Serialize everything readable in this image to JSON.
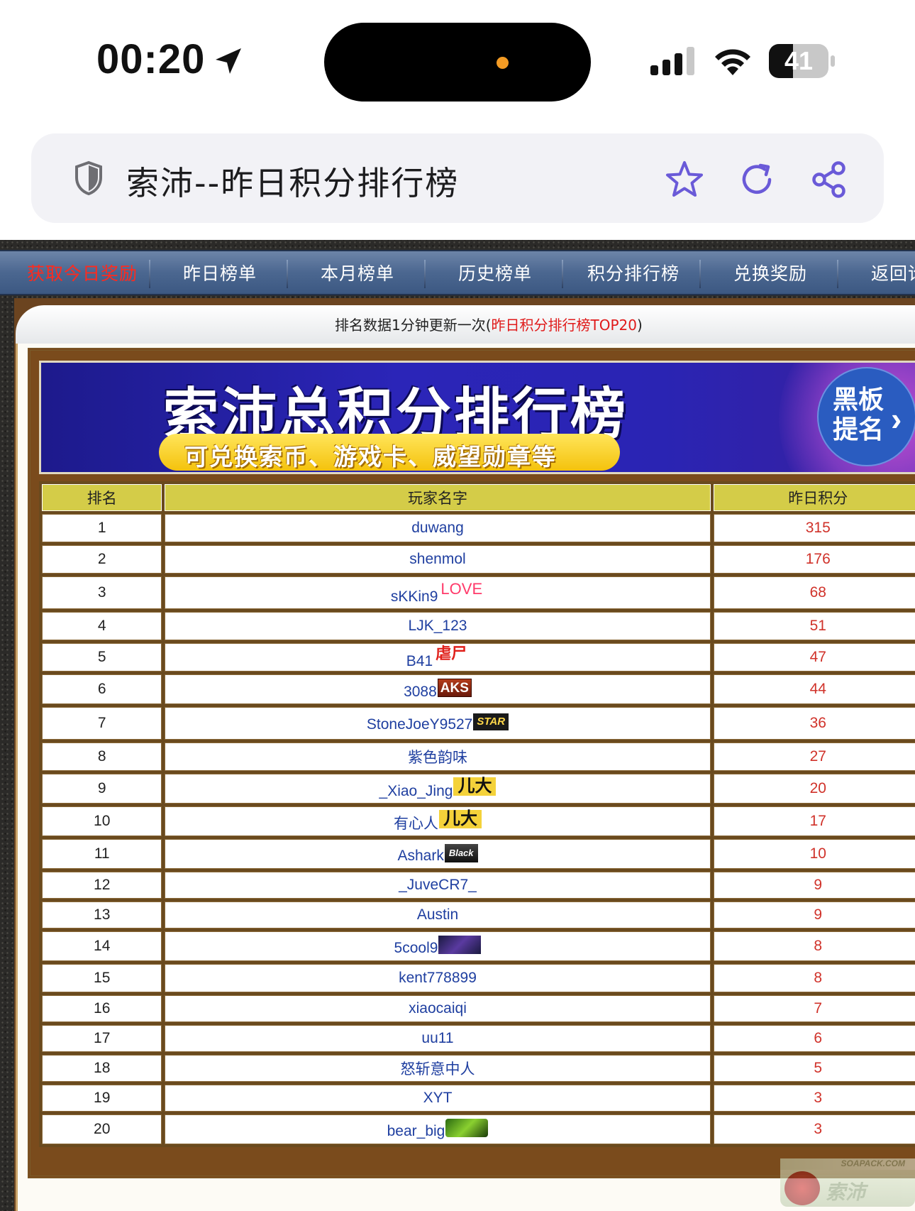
{
  "status_bar": {
    "time": "00:20",
    "battery": "41",
    "battery_level": 0.41
  },
  "browser": {
    "title": "索沛--昨日积分排行榜",
    "icons": [
      "shield-icon",
      "star-icon",
      "reload-icon",
      "share-icon"
    ]
  },
  "nav": {
    "items": [
      "获取今日奖励",
      "昨日榜单",
      "本月榜单",
      "历史榜单",
      "积分排行榜",
      "兑换奖励",
      "返回论"
    ]
  },
  "notice": {
    "prefix": "排名数据1分钟更新一次(",
    "highlight": "昨日积分排行榜TOP20",
    "suffix": ")"
  },
  "banner": {
    "title": "索沛总积分排行榜",
    "subtitle": "可兑换索币、游戏卡、威望勋章等",
    "side_button": "黑板提名"
  },
  "table": {
    "headers": [
      "排名",
      "玩家名字",
      "昨日积分"
    ],
    "rows": [
      {
        "rank": "1",
        "name": "duwang",
        "score": "315",
        "badge": ""
      },
      {
        "rank": "2",
        "name": "shenmol",
        "score": "176",
        "badge": ""
      },
      {
        "rank": "3",
        "name": "sKKin9",
        "score": "68",
        "badge": "LOVE"
      },
      {
        "rank": "4",
        "name": "LJK_123",
        "score": "51",
        "badge": ""
      },
      {
        "rank": "5",
        "name": "B41",
        "score": "47",
        "badge": "虐尸"
      },
      {
        "rank": "6",
        "name": "3088",
        "score": "44",
        "badge": "AKS"
      },
      {
        "rank": "7",
        "name": "StoneJoeY9527",
        "score": "36",
        "badge": "STAR"
      },
      {
        "rank": "8",
        "name": "紫色韵味",
        "score": "27",
        "badge": ""
      },
      {
        "rank": "9",
        "name": "_Xiao_Jing",
        "score": "20",
        "badge": "儿大"
      },
      {
        "rank": "10",
        "name": "有心人",
        "score": "17",
        "badge": "儿大"
      },
      {
        "rank": "11",
        "name": "Ashark",
        "score": "10",
        "badge": "Black"
      },
      {
        "rank": "12",
        "name": "_JuveCR7_",
        "score": "9",
        "badge": ""
      },
      {
        "rank": "13",
        "name": "Austin",
        "score": "9",
        "badge": ""
      },
      {
        "rank": "14",
        "name": "5cool9",
        "score": "8",
        "badge": "image"
      },
      {
        "rank": "15",
        "name": "kent778899",
        "score": "8",
        "badge": ""
      },
      {
        "rank": "16",
        "name": "xiaocaiqi",
        "score": "7",
        "badge": ""
      },
      {
        "rank": "17",
        "name": "uu11",
        "score": "6",
        "badge": ""
      },
      {
        "rank": "18",
        "name": "怒斩意中人",
        "score": "5",
        "badge": ""
      },
      {
        "rank": "19",
        "name": "XYT",
        "score": "3",
        "badge": ""
      },
      {
        "rank": "20",
        "name": "bear_big",
        "score": "3",
        "badge": "image"
      }
    ]
  },
  "watermark": {
    "site": "SOAPACK.COM",
    "logo": "索沛"
  }
}
